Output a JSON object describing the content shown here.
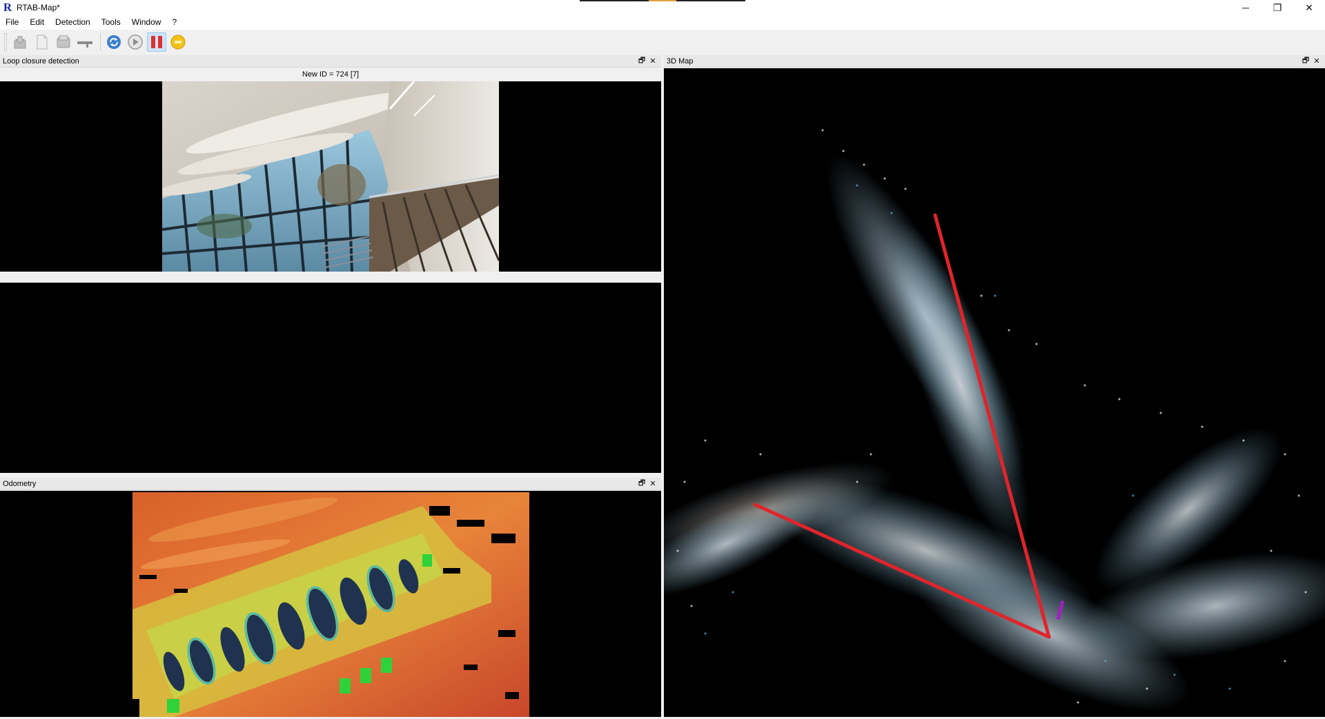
{
  "window": {
    "title": "RTAB-Map*",
    "logo_letter": "R",
    "controls": {
      "minimize": "─",
      "restore": "❐",
      "close": "✕"
    }
  },
  "menu": [
    "File",
    "Edit",
    "Detection",
    "Tools",
    "Window",
    "?"
  ],
  "toolbar": {
    "buttons": [
      {
        "name": "open-database",
        "icon": "open-db-icon"
      },
      {
        "name": "new-database",
        "icon": "new-doc-icon"
      },
      {
        "name": "close-database",
        "icon": "close-db-icon"
      },
      {
        "name": "edit-database",
        "icon": "edit-db-icon"
      },
      {
        "name": "initialize",
        "icon": "refresh-icon"
      },
      {
        "name": "start",
        "icon": "play-icon"
      },
      {
        "name": "pause",
        "icon": "pause-icon"
      },
      {
        "name": "stop",
        "icon": "stop-icon"
      }
    ]
  },
  "docks": {
    "loop_closure": {
      "title": "Loop closure detection",
      "new_id_label": "New ID = 724 [7]"
    },
    "odometry": {
      "title": "Odometry"
    },
    "map3d": {
      "title": "3D Map"
    },
    "float_glyph": "🗗",
    "close_glyph": "✕"
  },
  "colors": {
    "trajectory": "#e0242a",
    "pause_active": "#e03030",
    "stop_yellow": "#f2c21b",
    "toolbar_blue": "#2a6fbf"
  }
}
